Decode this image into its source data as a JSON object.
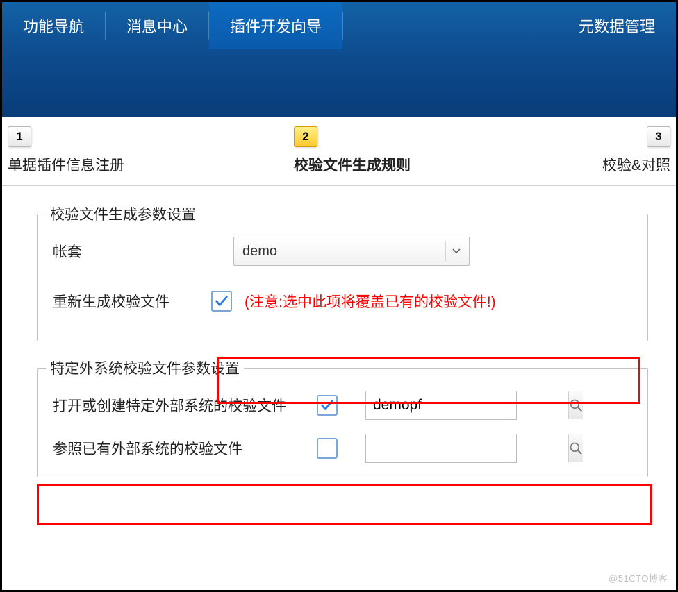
{
  "tabs": {
    "items": [
      {
        "label": "功能导航"
      },
      {
        "label": "消息中心"
      },
      {
        "label": "插件开发向导"
      },
      {
        "label": "元数据管理"
      }
    ],
    "activeIndex": 2
  },
  "steps": {
    "items": [
      {
        "num": "1",
        "label": "单据插件信息注册"
      },
      {
        "num": "2",
        "label": "校验文件生成规则"
      },
      {
        "num": "3",
        "label": "校验&对照"
      }
    ],
    "activeIndex": 1
  },
  "section1": {
    "legend": "校验文件生成参数设置",
    "account_label": "帐套",
    "account_value": "demo",
    "regen_label": "重新生成校验文件",
    "regen_checked": true,
    "regen_warning": "(注意:选中此项将覆盖已有的校验文件!)"
  },
  "section2": {
    "legend": "特定外系统校验文件参数设置",
    "open_label": "打开或创建特定外部系统的校验文件",
    "open_checked": true,
    "open_value": "demopf",
    "ref_label": "参照已有外部系统的校验文件",
    "ref_checked": false,
    "ref_value": ""
  },
  "watermark": "@51CTO博客"
}
